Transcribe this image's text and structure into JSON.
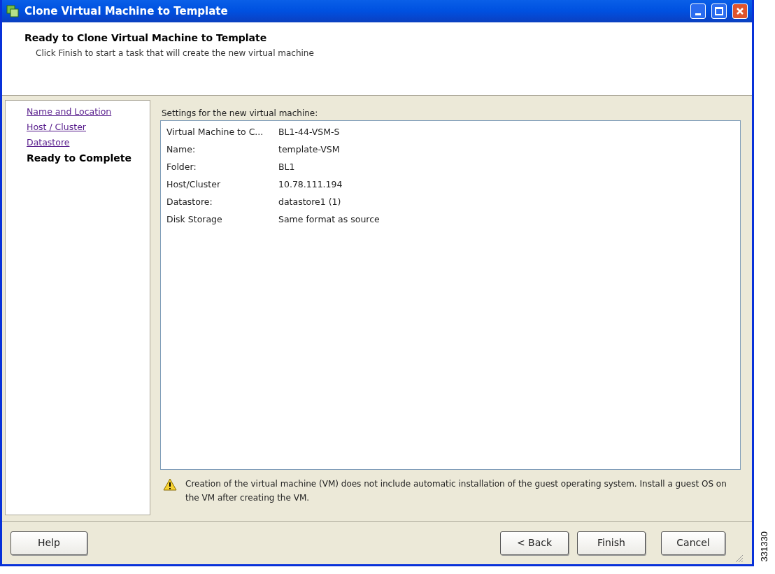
{
  "window": {
    "title": "Clone Virtual Machine to Template"
  },
  "header": {
    "title": "Ready to Clone Virtual Machine to Template",
    "subtitle": "Click Finish to start a task that will create the new virtual machine"
  },
  "steps": [
    {
      "label": "Name and Location",
      "selected": false
    },
    {
      "label": "Host / Cluster",
      "selected": false
    },
    {
      "label": "Datastore",
      "selected": false
    },
    {
      "label": "Ready to Complete",
      "selected": true
    }
  ],
  "settings": {
    "label": "Settings for the new virtual machine:",
    "rows": [
      {
        "name": "Virtual Machine to C...",
        "value": "BL1-44-VSM-S"
      },
      {
        "name": "Name:",
        "value": "template-VSM"
      },
      {
        "name": "Folder:",
        "value": "BL1"
      },
      {
        "name": "Host/Cluster",
        "value": "10.78.111.194"
      },
      {
        "name": "Datastore:",
        "value": "datastore1 (1)"
      },
      {
        "name": "Disk Storage",
        "value": "Same format as source"
      }
    ]
  },
  "warning": "Creation of the virtual machine (VM) does not include automatic installation of the guest operating system. Install a guest OS on the VM after creating the VM.",
  "buttons": {
    "help": "Help",
    "back": "< Back",
    "finish": "Finish",
    "cancel": "Cancel"
  },
  "figure_number": "331330"
}
